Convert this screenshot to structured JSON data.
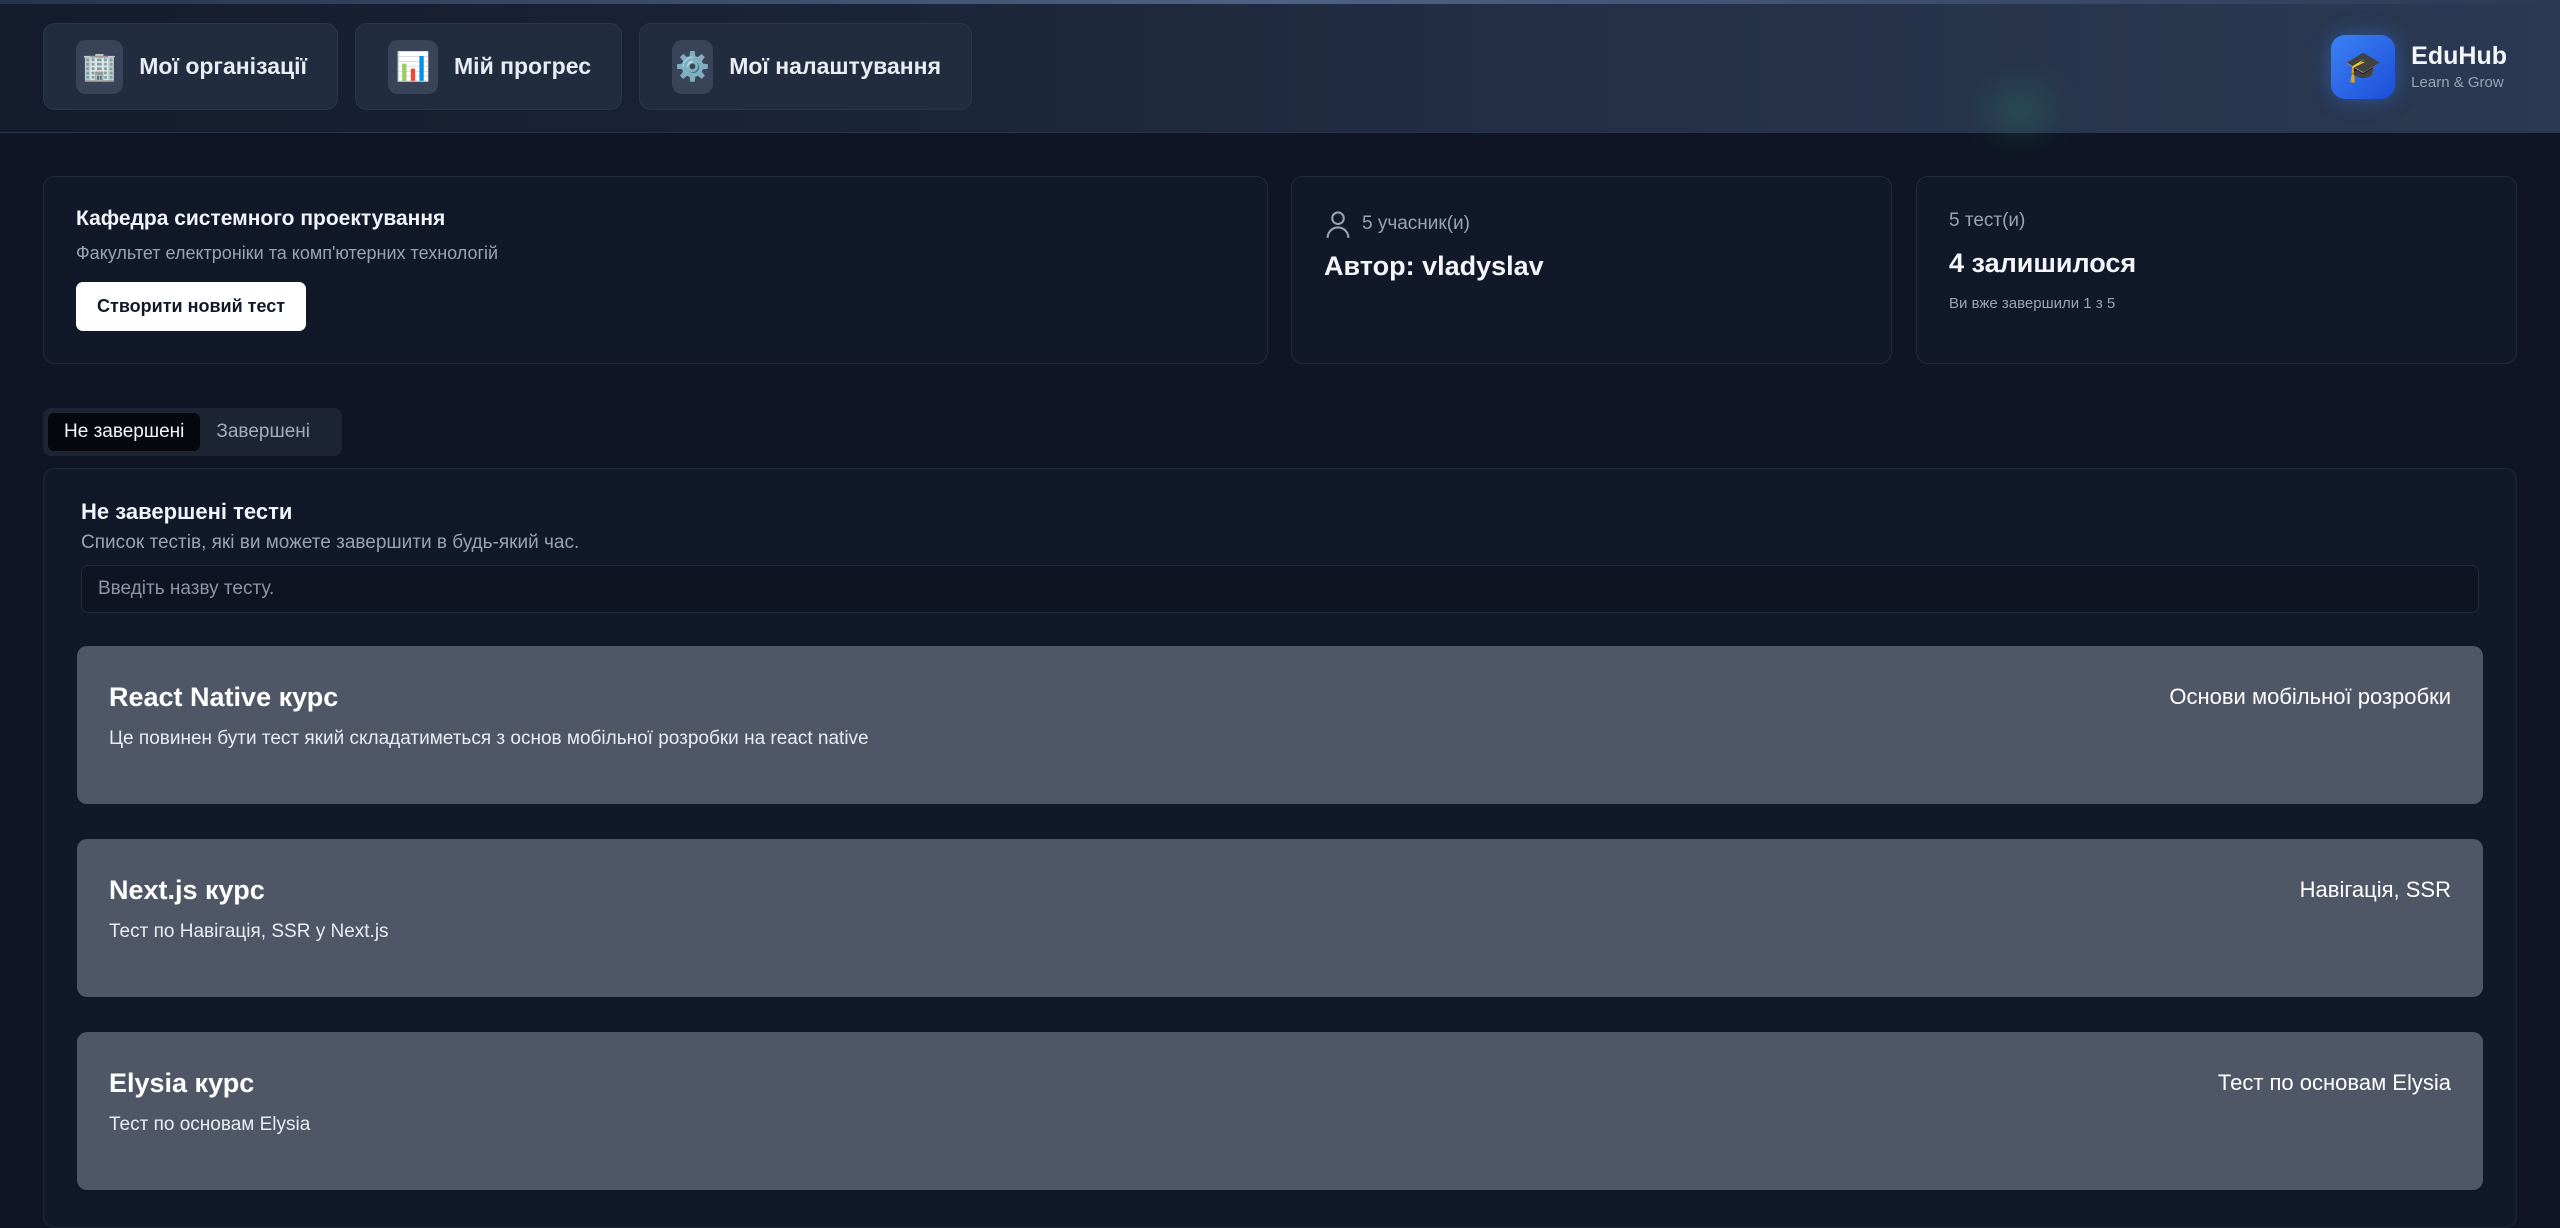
{
  "nav": {
    "items": [
      {
        "label": "Мої організації",
        "icon": "building-icon"
      },
      {
        "label": "Мій прогрес",
        "icon": "bar-chart-icon"
      },
      {
        "label": "Мої налаштування",
        "icon": "gear-icon"
      }
    ]
  },
  "brand": {
    "title": "EduHub",
    "subtitle": "Learn & Grow",
    "icon": "graduation-cap-icon"
  },
  "org": {
    "title": "Кафедра системного проектування",
    "subtitle": "Факультет електроніки та комп'ютерних технологій",
    "create_button": "Створити новий тест"
  },
  "members": {
    "count_label": "5 учасник(и)",
    "author_label": "Автор: vladyslav",
    "icon": "user-icon"
  },
  "tests_summary": {
    "count_label": "5 тест(и)",
    "remaining_label": "4 залишилося",
    "done_note": "Ви вже завершили 1 з 5"
  },
  "tabs": [
    {
      "label": "Не завершені",
      "active": true
    },
    {
      "label": "Завершені",
      "active": false
    }
  ],
  "list": {
    "title": "Не завершені тести",
    "subtitle": "Список тестів, які ви можете завершити в будь-який час.",
    "search_placeholder": "Введіть назву тесту.",
    "items": [
      {
        "name": "React Native курс",
        "tag": "Основи мобільної розробки",
        "description": "Це повинен бути тест який складатиметься з основ мобільної розробки на react native"
      },
      {
        "name": "Next.js курс",
        "tag": "Навігація, SSR",
        "description": "Тест по Навігація, SSR у Next.js"
      },
      {
        "name": "Elysia курс",
        "tag": "Тест по основам Elysia",
        "description": "Тест по основам Elysia"
      }
    ]
  },
  "colors": {
    "accent": "#3b82f6",
    "card": "#4f5766",
    "background": "#0f1524"
  }
}
